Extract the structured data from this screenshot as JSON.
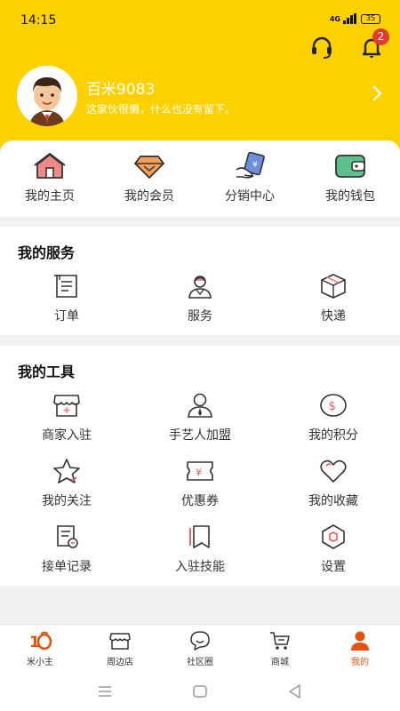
{
  "status_bar": {
    "time": "14:15",
    "network": "4G",
    "battery": "35"
  },
  "header": {
    "username": "百米9083",
    "bio": "这家伙很懒，什么也没有留下。",
    "notification_count": "2",
    "accent_color": "#fdd100"
  },
  "quick_links": [
    {
      "label": "我的主页",
      "icon": "home-icon"
    },
    {
      "label": "我的会员",
      "icon": "diamond-icon"
    },
    {
      "label": "分销中心",
      "icon": "distribution-icon"
    },
    {
      "label": "我的钱包",
      "icon": "wallet-icon"
    }
  ],
  "services": {
    "title": "我的服务",
    "items": [
      {
        "label": "订单",
        "icon": "order-icon"
      },
      {
        "label": "服务",
        "icon": "service-worker-icon"
      },
      {
        "label": "快递",
        "icon": "package-icon"
      }
    ]
  },
  "tools": {
    "title": "我的工具",
    "items": [
      {
        "label": "商家入驻",
        "icon": "shop-icon"
      },
      {
        "label": "手艺人加盟",
        "icon": "craftsman-icon"
      },
      {
        "label": "我的积分",
        "icon": "points-coin-icon"
      },
      {
        "label": "我的关注",
        "icon": "star-icon"
      },
      {
        "label": "优惠券",
        "icon": "coupon-icon"
      },
      {
        "label": "我的收藏",
        "icon": "heart-icon"
      },
      {
        "label": "接单记录",
        "icon": "record-icon"
      },
      {
        "label": "入驻技能",
        "icon": "skill-book-icon"
      },
      {
        "label": "设置",
        "icon": "settings-icon"
      }
    ]
  },
  "tabbar": {
    "items": [
      {
        "label": "米小主",
        "icon": "mixiaozhu-logo-icon"
      },
      {
        "label": "周边店",
        "icon": "store-icon"
      },
      {
        "label": "社区圈",
        "icon": "chat-bubble-icon"
      },
      {
        "label": "商城",
        "icon": "cart-icon"
      },
      {
        "label": "我的",
        "icon": "user-icon",
        "active": true
      }
    ],
    "active_color": "#e4520f"
  }
}
